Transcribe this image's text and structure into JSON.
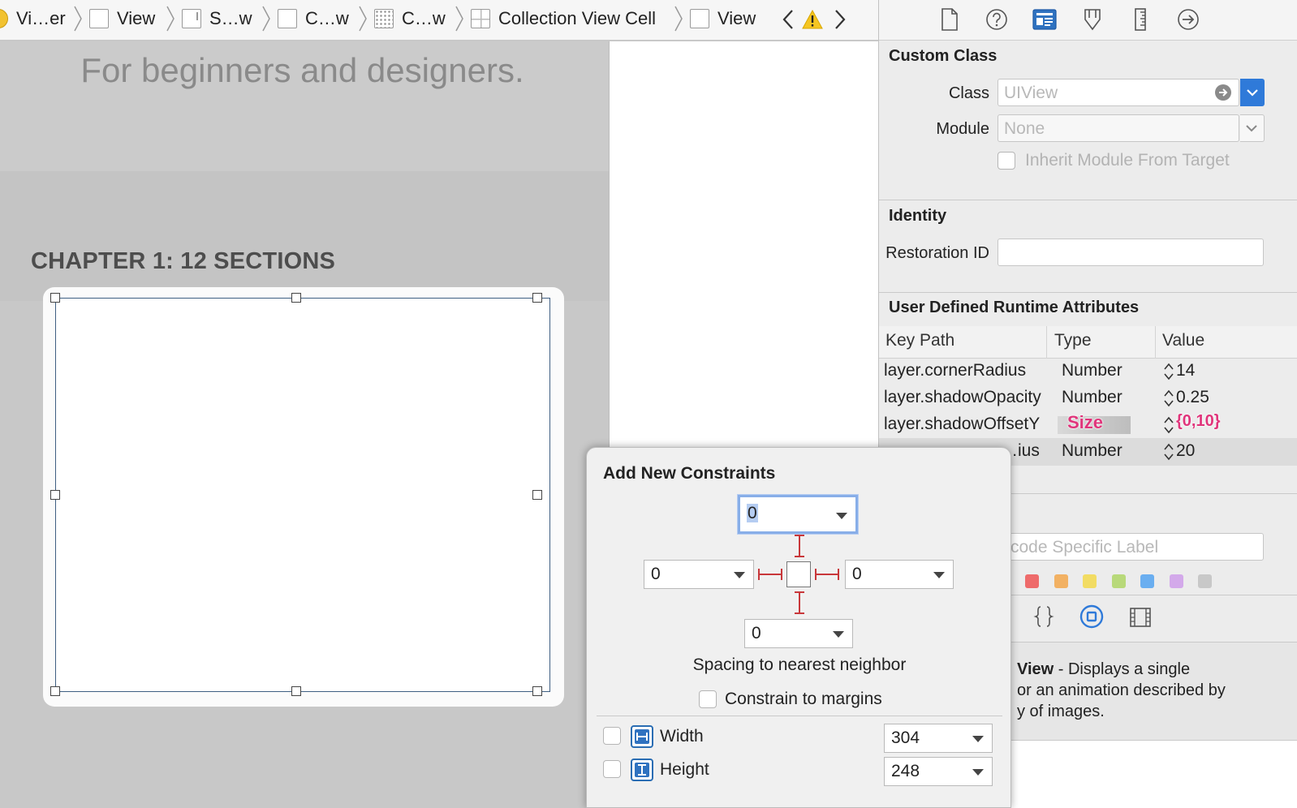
{
  "breadcrumb": {
    "items": [
      {
        "label": "Vi…er",
        "icon": "view-controller-icon"
      },
      {
        "label": "View",
        "icon": "view-icon"
      },
      {
        "label": "S…w",
        "icon": "scroll-view-icon"
      },
      {
        "label": "C…w",
        "icon": "view-icon"
      },
      {
        "label": "C…w",
        "icon": "collection-view-icon"
      },
      {
        "label": "Collection View Cell",
        "icon": "collection-view-cell-icon"
      },
      {
        "label": "View",
        "icon": "view-icon"
      }
    ]
  },
  "canvas": {
    "subtitle": "For beginners and designers.",
    "chapter_heading": "CHAPTER 1: 12 SECTIONS"
  },
  "inspector": {
    "custom_class": {
      "title": "Custom Class",
      "class_label": "Class",
      "class_placeholder": "UIView",
      "module_label": "Module",
      "module_placeholder": "None",
      "inherit_label": "Inherit Module From Target"
    },
    "identity": {
      "title": "Identity",
      "restoration_label": "Restoration ID",
      "restoration_value": ""
    },
    "udra": {
      "title": "User Defined Runtime Attributes",
      "columns": [
        "Key Path",
        "Type",
        "Value"
      ],
      "rows": [
        {
          "key": "layer.cornerRadius",
          "type": "Number",
          "value": "14"
        },
        {
          "key": "layer.shadowOpacity",
          "type": "Number",
          "value": "0.25"
        },
        {
          "key": "layer.shadowOffsetY",
          "type": "Size",
          "value": "{0,10}"
        },
        {
          "key": "…ius",
          "type": "Number",
          "value": "20"
        }
      ]
    },
    "label_placeholder": "Xcode Specific Label",
    "label_colors": [
      "#ee6b6b",
      "#f2b163",
      "#f2dc63",
      "#b8d97a",
      "#6aaef0",
      "#d3a9ea",
      "#c8c8c8"
    ],
    "description": {
      "bold": "View",
      "lines": [
        " - Displays a single",
        "or an animation described by",
        "y of images."
      ]
    }
  },
  "constraints_popover": {
    "title": "Add New Constraints",
    "top": "0",
    "left": "0",
    "right": "0",
    "bottom": "0",
    "spacing_label": "Spacing to nearest neighbor",
    "constrain_margins_label": "Constrain to margins",
    "width_label": "Width",
    "width_value": "304",
    "height_label": "Height",
    "height_value": "248"
  }
}
